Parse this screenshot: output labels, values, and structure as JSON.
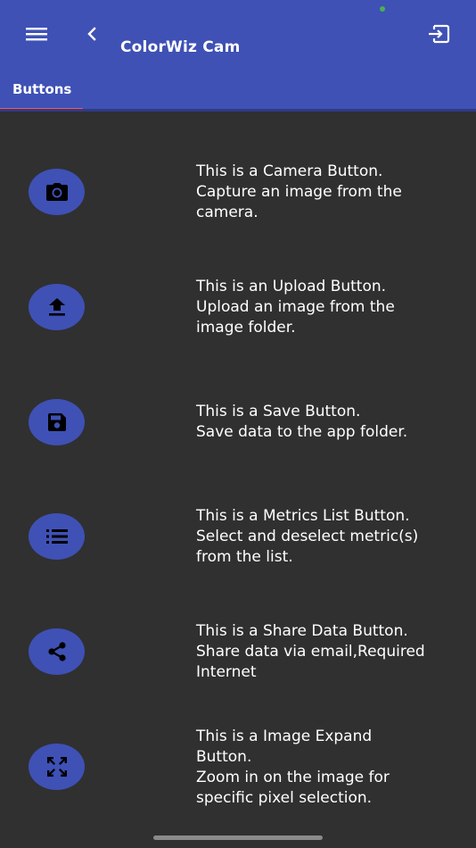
{
  "header": {
    "title": "ColorWiz Cam",
    "menu_icon": "hamburger-menu-icon",
    "back_icon": "chevron-left-icon",
    "logout_icon": "exit-to-app-icon"
  },
  "tabs": [
    {
      "label": "Buttons",
      "selected": true
    }
  ],
  "colors": {
    "primary": "#3f51b5",
    "background": "#303030",
    "tab_indicator": "#ff5252",
    "text": "#ffffff"
  },
  "buttons": [
    {
      "icon": "camera-icon",
      "lines": [
        "This is a Camera Button.",
        "Capture an image from the",
        "camera."
      ]
    },
    {
      "icon": "upload-icon",
      "lines": [
        "This is an Upload Button.",
        "Upload an image from the",
        "image folder."
      ]
    },
    {
      "icon": "save-icon",
      "lines": [
        "This is a Save Button.",
        "Save data to the app folder."
      ]
    },
    {
      "icon": "list-icon",
      "lines": [
        "This is a Metrics List Button.",
        "Select and deselect metric(s)",
        "from the list."
      ]
    },
    {
      "icon": "share-icon",
      "lines": [
        "This is a Share Data Button.",
        "Share data via email,Required",
        "Internet"
      ]
    },
    {
      "icon": "expand-icon",
      "lines": [
        "This is a Image Expand",
        "Button.",
        "Zoom in on the image for",
        "specific pixel selection."
      ]
    }
  ]
}
